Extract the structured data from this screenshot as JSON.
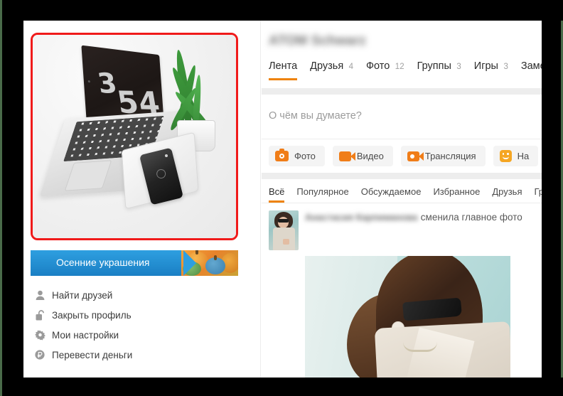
{
  "profile": {
    "name_blurred": "АТОМ Schwarz",
    "photo": {
      "alt": "workspace-photo",
      "laptop_screen_digits": [
        "3",
        "54"
      ],
      "highlight_color": "#f01a1a"
    },
    "tabs": [
      {
        "label": "Лента",
        "count": "",
        "active": true
      },
      {
        "label": "Друзья",
        "count": "4",
        "active": false
      },
      {
        "label": "Фото",
        "count": "12",
        "active": false
      },
      {
        "label": "Группы",
        "count": "3",
        "active": false
      },
      {
        "label": "Игры",
        "count": "3",
        "active": false
      },
      {
        "label": "Заметки",
        "count": "",
        "active": false
      }
    ]
  },
  "banner": {
    "title": "Осенние украшения"
  },
  "sidebar": {
    "items": [
      {
        "label": "Найти друзей",
        "icon": "person-icon"
      },
      {
        "label": "Закрыть профиль",
        "icon": "open-lock-icon"
      },
      {
        "label": "Мои настройки",
        "icon": "gear-icon"
      },
      {
        "label": "Перевести деньги",
        "icon": "ruble-icon"
      }
    ]
  },
  "composer": {
    "placeholder": "О чём вы думаете?",
    "actions": [
      {
        "label": "Фото",
        "icon": "camera-icon"
      },
      {
        "label": "Видео",
        "icon": "video-camera-icon"
      },
      {
        "label": "Трансляция",
        "icon": "live-broadcast-icon"
      },
      {
        "label": "На",
        "icon": "smiley-icon"
      }
    ]
  },
  "feed": {
    "filters": [
      {
        "label": "Всё",
        "active": true
      },
      {
        "label": "Популярное",
        "active": false
      },
      {
        "label": "Обсуждаемое",
        "active": false
      },
      {
        "label": "Избранное",
        "active": false
      },
      {
        "label": "Друзья",
        "active": false
      },
      {
        "label": "Группы",
        "active": false
      }
    ],
    "posts": [
      {
        "author_blurred": "Анастасия Карпиманова",
        "action": "сменила главное фото",
        "photo_alt": "woman-in-sunglasses-photo"
      }
    ]
  },
  "colors": {
    "accent_orange": "#ee8208",
    "icon_orange": "#f07d18",
    "highlight_red": "#f01a1a",
    "banner_blue": "#1a7fc4",
    "page_bg": "#ededed"
  }
}
